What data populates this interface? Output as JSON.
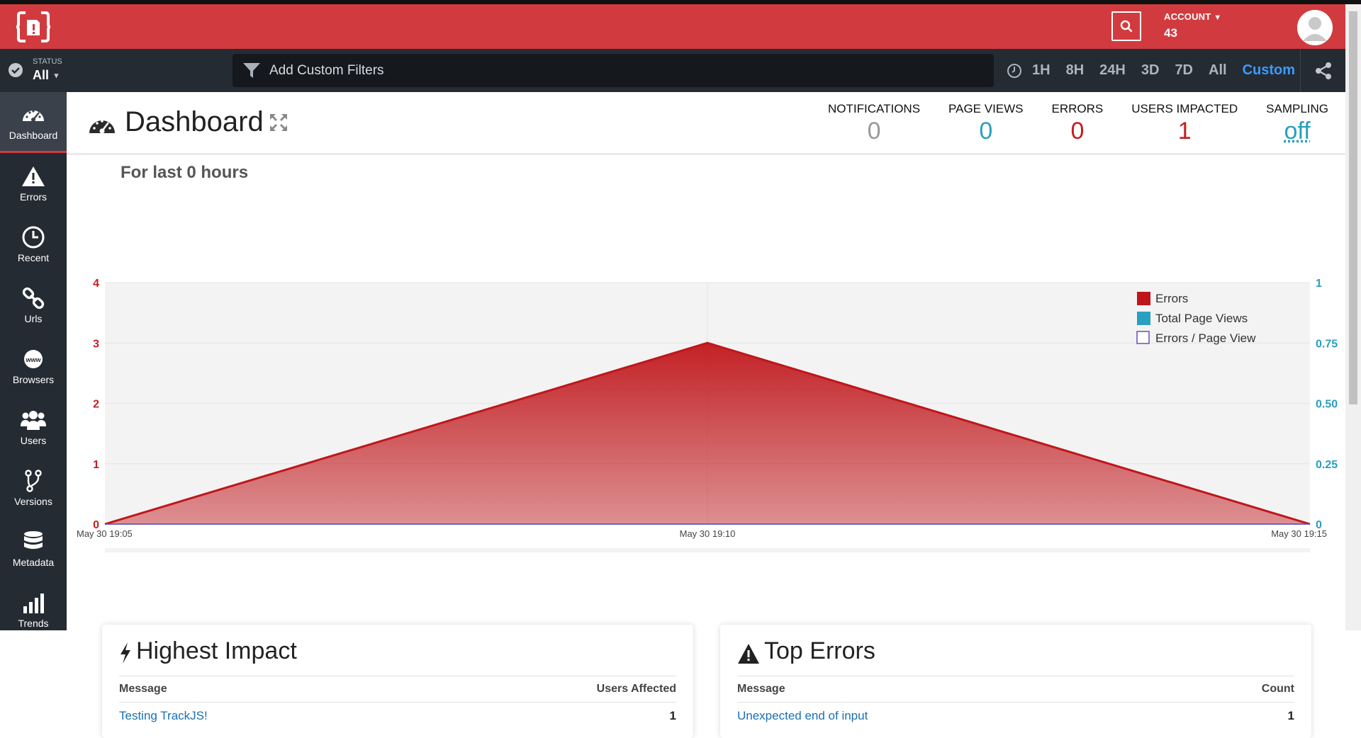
{
  "header": {
    "account_label": "ACCOUNT",
    "account_value": "43"
  },
  "filterbar": {
    "status_label": "STATUS",
    "status_value": "All",
    "filter_placeholder": "Add Custom Filters",
    "ranges": [
      "1H",
      "8H",
      "24H",
      "3D",
      "7D",
      "All",
      "Custom"
    ],
    "active_range": "Custom"
  },
  "sidebar": {
    "items": [
      {
        "label": "Dashboard",
        "icon": "gauge-icon"
      },
      {
        "label": "Errors",
        "icon": "warning-icon"
      },
      {
        "label": "Recent",
        "icon": "clock-icon"
      },
      {
        "label": "Urls",
        "icon": "link-icon"
      },
      {
        "label": "Browsers",
        "icon": "www-icon"
      },
      {
        "label": "Users",
        "icon": "users-icon"
      },
      {
        "label": "Versions",
        "icon": "branch-icon"
      },
      {
        "label": "Metadata",
        "icon": "database-icon"
      },
      {
        "label": "Trends",
        "icon": "trend-bars-icon"
      }
    ]
  },
  "page": {
    "title": "Dashboard",
    "subtitle": "For last 0 hours"
  },
  "stats": [
    {
      "label": "NOTIFICATIONS",
      "value": "0",
      "color": "#999999"
    },
    {
      "label": "PAGE VIEWS",
      "value": "0",
      "color": "#2a9fbe"
    },
    {
      "label": "ERRORS",
      "value": "0",
      "color": "#c41e1e"
    },
    {
      "label": "USERS IMPACTED",
      "value": "1",
      "color": "#c41e1e"
    },
    {
      "label": "SAMPLING",
      "value": "off",
      "color": "#2a9fbe"
    }
  ],
  "chart_data": {
    "type": "area",
    "x": [
      "May 30 19:05",
      "May 30 19:10",
      "May 30 19:15"
    ],
    "series": [
      {
        "name": "Errors",
        "values": [
          0,
          3,
          0
        ],
        "axis": "left",
        "color": "#c0161b"
      },
      {
        "name": "Total Page Views",
        "values": [
          0,
          0,
          0
        ],
        "axis": "right",
        "color": "#2aa0c0"
      },
      {
        "name": "Errors / Page View",
        "values": [
          0,
          0,
          0
        ],
        "axis": "right",
        "color": "#6a4fb3"
      }
    ],
    "y_left_ticks": [
      "0",
      "1",
      "2",
      "3",
      "4"
    ],
    "y_right_ticks": [
      "0",
      "0.25",
      "0.50",
      "0.75",
      "1"
    ],
    "y_left_range": [
      0,
      4
    ],
    "y_right_range": [
      0,
      1
    ],
    "x_tick_labels": [
      "May 30 19:05",
      "May 30 19:10",
      "May 30 19:15"
    ],
    "legend": [
      "Errors",
      "Total Page Views",
      "Errors / Page View"
    ],
    "legend_position": "top-right",
    "grid": true
  },
  "cards": {
    "impact": {
      "title": "Highest Impact",
      "col1": "Message",
      "col2": "Users Affected",
      "rows": [
        {
          "message": "Testing TrackJS!",
          "count": "1"
        }
      ]
    },
    "errors": {
      "title": "Top Errors",
      "col1": "Message",
      "col2": "Count",
      "rows": [
        {
          "message": "Unexpected end of input",
          "count": "1"
        }
      ]
    }
  }
}
